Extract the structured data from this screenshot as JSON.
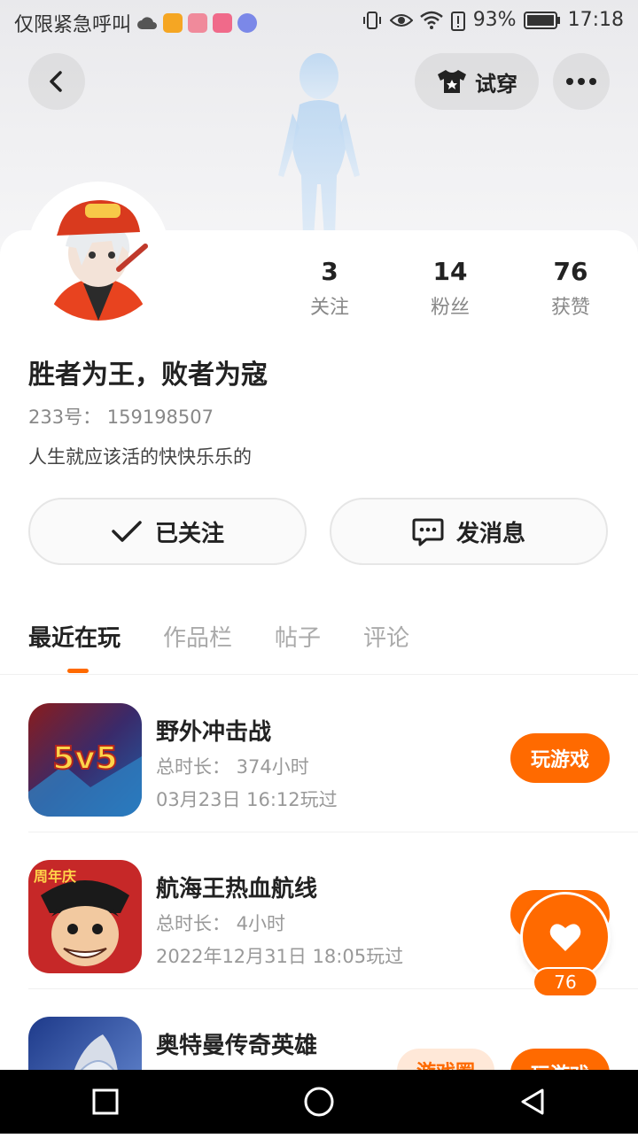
{
  "status_bar": {
    "carrier_text": "仅限紧急呼叫",
    "battery": "93%",
    "time": "17:18"
  },
  "header": {
    "try_on_label": "试穿"
  },
  "profile": {
    "stats": [
      {
        "value": "3",
        "label": "关注"
      },
      {
        "value": "14",
        "label": "粉丝"
      },
      {
        "value": "76",
        "label": "获赞"
      }
    ],
    "nickname": "胜者为王，败者为寇",
    "uid_text": "233号：  159198507",
    "bio": "人生就应该活的快快乐乐的",
    "follow_button_label": "已关注",
    "message_button_label": "发消息"
  },
  "tabs": [
    {
      "label": "最近在玩",
      "active": true
    },
    {
      "label": "作品栏",
      "active": false
    },
    {
      "label": "帖子",
      "active": false
    },
    {
      "label": "评论",
      "active": false
    }
  ],
  "games": [
    {
      "title": "野外冲击战",
      "duration": "总时长：  374小时",
      "last_played": "03月23日 16:12玩过",
      "button": "玩游戏",
      "icon_text": "5v5"
    },
    {
      "title": "航海王热血航线",
      "duration": "总时长：  4小时",
      "last_played": "2022年12月31日 18:05玩过",
      "button": "玩游戏",
      "icon_text": "周年庆"
    },
    {
      "title": "奥特曼传奇英雄",
      "duration": "",
      "last_played": "",
      "button": "玩游戏",
      "tag": "游戏圈"
    }
  ],
  "floating_like": {
    "count": "76"
  },
  "colors": {
    "accent": "#ff6a00",
    "text_primary": "#222222",
    "text_secondary": "#999999"
  }
}
